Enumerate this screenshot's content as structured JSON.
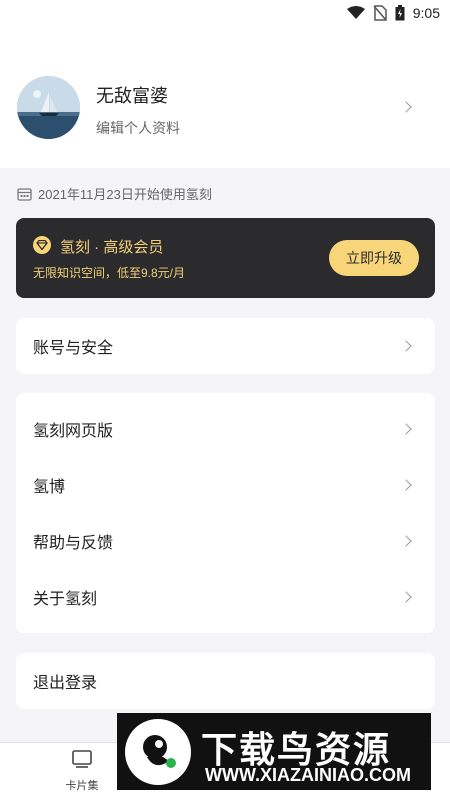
{
  "status_bar": {
    "time": "9:05"
  },
  "profile": {
    "name": "无敌富婆",
    "edit_label": "编辑个人资料"
  },
  "since": {
    "text": "2021年11月23日开始使用氢刻"
  },
  "vip": {
    "title": "氢刻 · 高级会员",
    "subtitle": "无限知识空间，低至9.8元/月",
    "button_label": "立即升级"
  },
  "menu": {
    "account": "账号与安全",
    "web": "氢刻网页版",
    "blog": "氢博",
    "help": "帮助与反馈",
    "about": "关于氢刻",
    "logout": "退出登录"
  },
  "nav": {
    "cards": "卡片集"
  },
  "watermark": {
    "title": "下载鸟资源",
    "url": "WWW.XIAZAINIAO.COM"
  },
  "colors": {
    "gold": "#f7d578",
    "dark_card": "#2b2b2d",
    "background": "#f5f5f7"
  }
}
